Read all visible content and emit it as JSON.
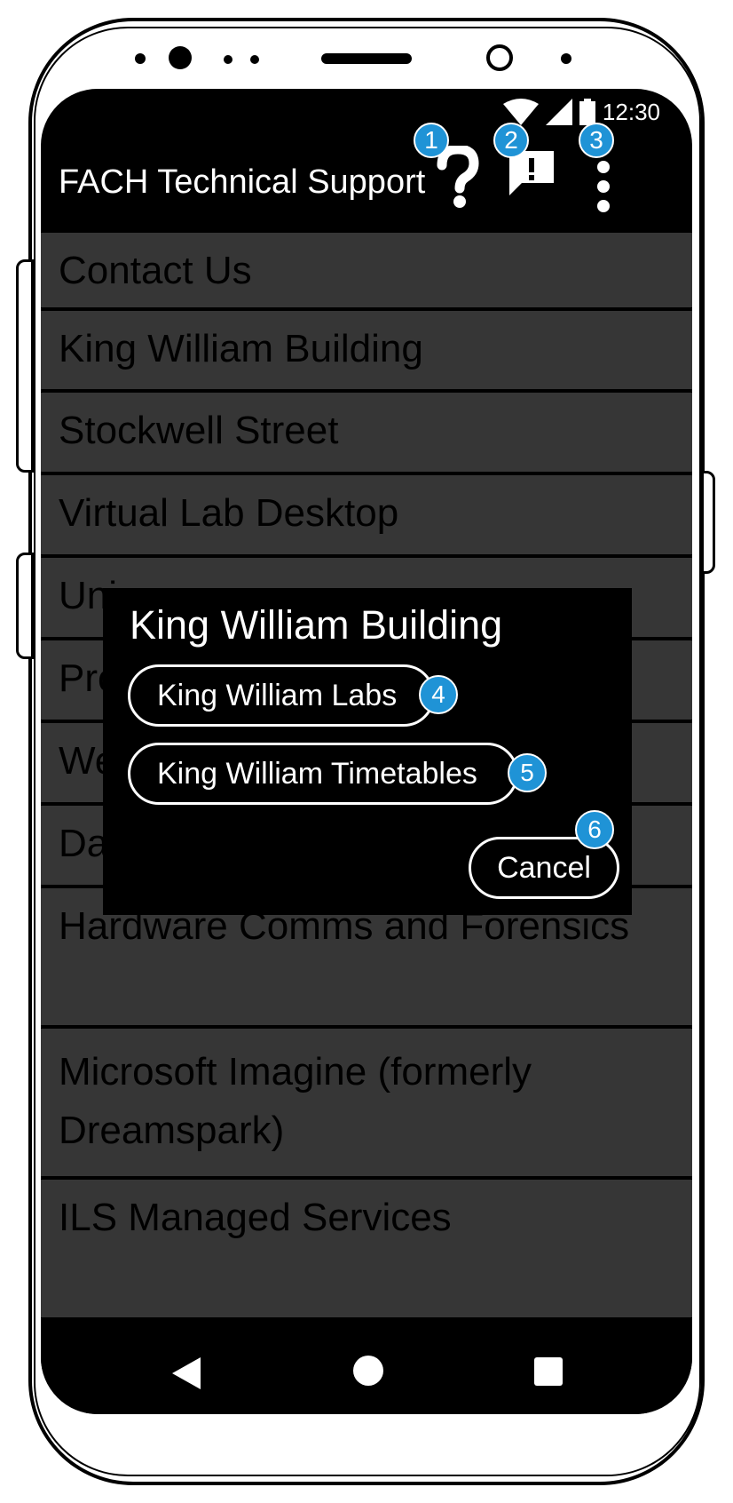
{
  "status_bar": {
    "time": "12:30"
  },
  "app_bar": {
    "title": "FACH Technical Support",
    "badges": {
      "help": "1",
      "feedback": "2",
      "more": "3"
    }
  },
  "list": {
    "items": [
      "Contact Us",
      "King William Building",
      "Stockwell Street",
      "Virtual Lab Desktop",
      "Uni",
      "Pro",
      "We",
      "Da",
      "Hardware Comms and Forensics",
      "Microsoft Imagine (formerly Dreamspark)",
      "ILS Managed Services"
    ]
  },
  "dialog": {
    "title": "King William Building",
    "option_labs": "King William Labs",
    "option_timetables": "King William Timetables",
    "cancel": "Cancel",
    "badges": {
      "labs": "4",
      "timetables": "5",
      "cancel": "6"
    }
  },
  "colors": {
    "badge": "#1f93d6",
    "list_item_bg": "#363636",
    "screen_bg": "#000000"
  },
  "icons": [
    "wifi-icon",
    "signal-icon",
    "battery-icon",
    "help-icon",
    "feedback-icon",
    "more-vert-icon",
    "back-icon",
    "home-icon",
    "recents-icon"
  ]
}
